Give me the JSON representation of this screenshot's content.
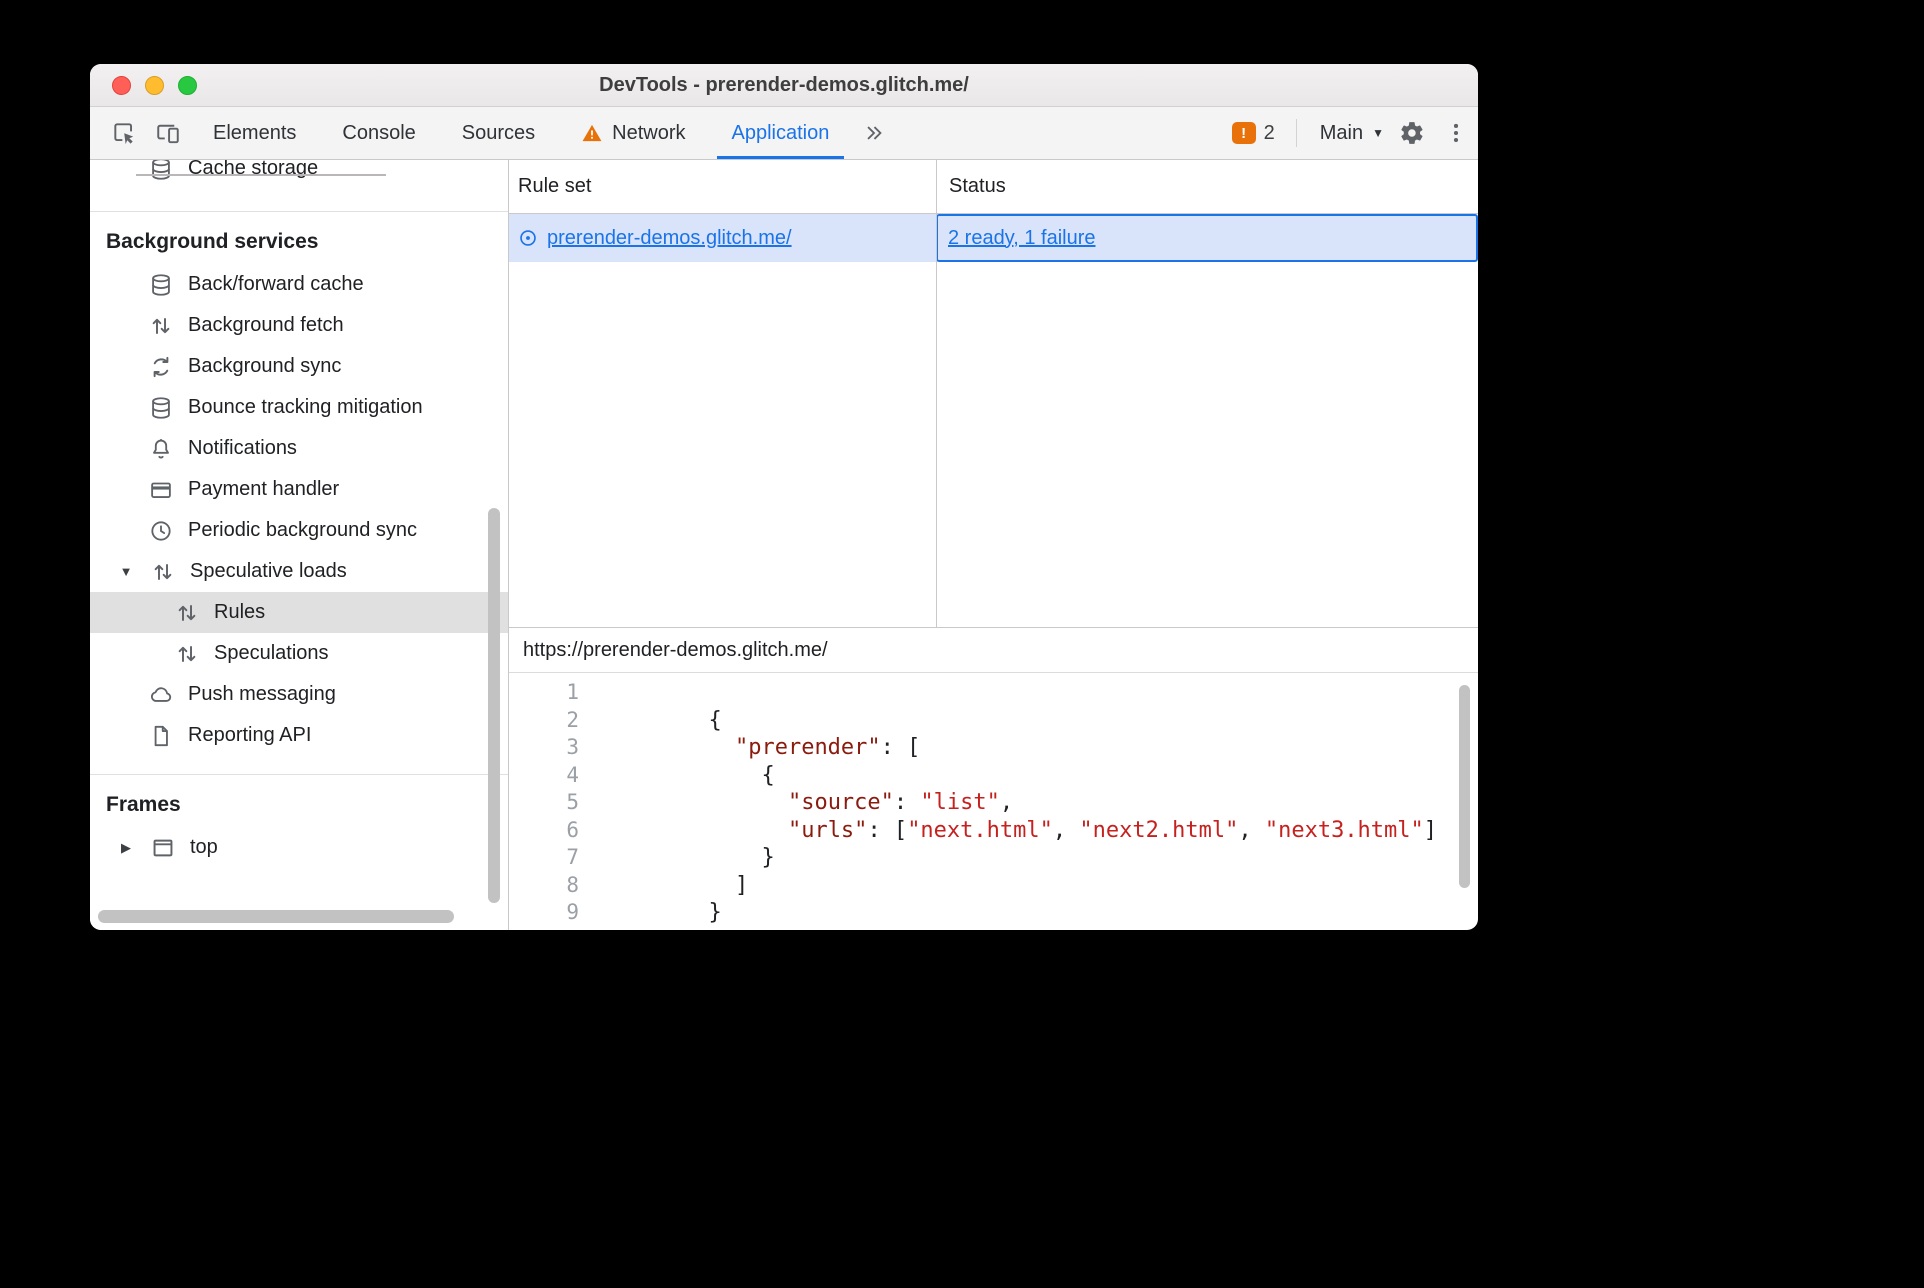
{
  "colors": {
    "accent": "#1a73e8",
    "warning": "#e8710a",
    "row-selected": "#d9e4fa",
    "item-selected": "#e0e0e0",
    "code-key": "#8a1c0f",
    "code-string": "#c5221f",
    "icon-gray": "#5f6368"
  },
  "carets": {
    "expanded": "▼",
    "collapsed": "▶",
    "dropdown": "▼"
  },
  "window": {
    "title": "DevTools - prerender-demos.glitch.me/"
  },
  "toolbar": {
    "tabs": {
      "elements": "Elements",
      "console": "Console",
      "sources": "Sources",
      "network": "Network",
      "application": "Application"
    },
    "issue_count": "2",
    "target_label": "Main"
  },
  "sidebar": {
    "clipped_item": "Cache storage",
    "background_header": "Background services",
    "items": [
      {
        "label": "Back/forward cache"
      },
      {
        "label": "Background fetch"
      },
      {
        "label": "Background sync"
      },
      {
        "label": "Bounce tracking mitigation"
      },
      {
        "label": "Notifications"
      },
      {
        "label": "Payment handler"
      },
      {
        "label": "Periodic background sync"
      },
      {
        "label": "Speculative loads"
      },
      {
        "label": "Rules"
      },
      {
        "label": "Speculations"
      },
      {
        "label": "Push messaging"
      },
      {
        "label": "Reporting API"
      }
    ],
    "frames_header": "Frames",
    "frames_top": "top"
  },
  "rules_table": {
    "col_rule_set": "Rule set",
    "col_status": "Status",
    "row": {
      "rule_set": "prerender-demos.glitch.me/",
      "status": "2 ready, 1 failure"
    }
  },
  "preview": {
    "url": "https://prerender-demos.glitch.me/",
    "lines": [
      {
        "n": "1",
        "tokens": []
      },
      {
        "n": "2",
        "tokens": [
          {
            "c": "pln",
            "v": "      {"
          }
        ]
      },
      {
        "n": "3",
        "tokens": [
          {
            "c": "pln",
            "v": "        "
          },
          {
            "c": "key",
            "v": "\"prerender\""
          },
          {
            "c": "pln",
            "v": ": ["
          }
        ]
      },
      {
        "n": "4",
        "tokens": [
          {
            "c": "pln",
            "v": "          {"
          }
        ]
      },
      {
        "n": "5",
        "tokens": [
          {
            "c": "pln",
            "v": "            "
          },
          {
            "c": "key",
            "v": "\"source\""
          },
          {
            "c": "pln",
            "v": ": "
          },
          {
            "c": "str",
            "v": "\"list\""
          },
          {
            "c": "pln",
            "v": ","
          }
        ]
      },
      {
        "n": "6",
        "tokens": [
          {
            "c": "pln",
            "v": "            "
          },
          {
            "c": "key",
            "v": "\"urls\""
          },
          {
            "c": "pln",
            "v": ": ["
          },
          {
            "c": "str",
            "v": "\"next.html\""
          },
          {
            "c": "pln",
            "v": ", "
          },
          {
            "c": "str",
            "v": "\"next2.html\""
          },
          {
            "c": "pln",
            "v": ", "
          },
          {
            "c": "str",
            "v": "\"next3.html\""
          },
          {
            "c": "pln",
            "v": "]"
          }
        ]
      },
      {
        "n": "7",
        "tokens": [
          {
            "c": "pln",
            "v": "          }"
          }
        ]
      },
      {
        "n": "8",
        "tokens": [
          {
            "c": "pln",
            "v": "        ]"
          }
        ]
      },
      {
        "n": "9",
        "tokens": [
          {
            "c": "pln",
            "v": "      }"
          }
        ]
      }
    ]
  }
}
